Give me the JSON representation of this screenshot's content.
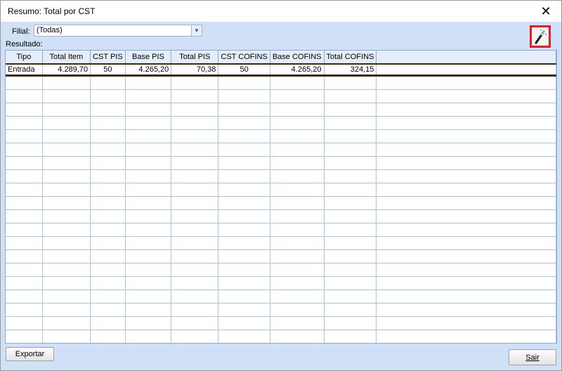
{
  "window": {
    "title": "Resumo: Total por CST",
    "close_glyph": "✕"
  },
  "filter": {
    "label": "Filial:",
    "value": "(Todas)",
    "arrow_glyph": "▼"
  },
  "toolbar": {
    "wand_icon": "magic-wand-icon"
  },
  "grid": {
    "caption": "Resultado:",
    "columns": [
      "Tipo",
      "Total Item",
      "CST PIS",
      "Base PIS",
      "Total PIS",
      "CST COFINS",
      "Base COFINS",
      "Total COFINS"
    ],
    "rows": [
      [
        "Entrada",
        "4.289,70",
        "50",
        "4.265,20",
        "70,38",
        "50",
        "4.265,20",
        "324,15"
      ]
    ]
  },
  "buttons": {
    "export": "Exportar",
    "exit": "Sair"
  }
}
